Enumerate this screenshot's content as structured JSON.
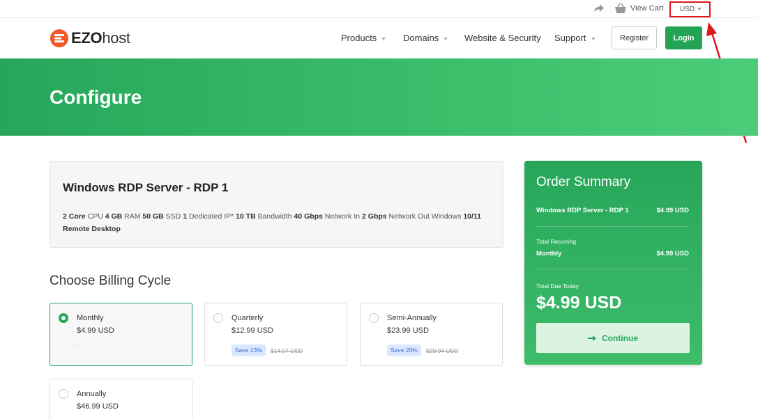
{
  "topbar": {
    "share_icon": "share-arrow-icon",
    "cart_icon": "basket-icon",
    "view_cart": "View Cart",
    "currency": "USD"
  },
  "header": {
    "logo_part1": "EZO",
    "logo_part2": "host",
    "nav": [
      "Products",
      "Domains",
      "Website & Security",
      "Support"
    ],
    "register": "Register",
    "login": "Login"
  },
  "hero": {
    "title": "Configure"
  },
  "product": {
    "name": "Windows RDP Server - RDP 1",
    "specs": [
      {
        "bold": "2 Core",
        "text": " CPU "
      },
      {
        "bold": "4 GB",
        "text": " RAM "
      },
      {
        "bold": "50 GB",
        "text": " SSD "
      },
      {
        "bold": "1",
        "text": " Dedicated IP* "
      },
      {
        "bold": "10 TB",
        "text": " Bandwidth "
      },
      {
        "bold": "40 Gbps",
        "text": " Network In "
      },
      {
        "bold": "2 Gbps",
        "text": " Network Out Windows "
      },
      {
        "bold": "10/11 Remote Desktop",
        "text": ""
      }
    ]
  },
  "billing": {
    "title": "Choose Billing Cycle",
    "options": [
      {
        "name": "Monthly",
        "price": "$4.99 USD",
        "note": "-",
        "selected": true
      },
      {
        "name": "Quarterly",
        "price": "$12.99 USD",
        "save": "Save 13%",
        "old": "$14.97 USD"
      },
      {
        "name": "Semi-Annually",
        "price": "$23.99 USD",
        "save": "Save 20%",
        "old": "$29.94 USD"
      },
      {
        "name": "Annually",
        "price": "$46.99 USD"
      }
    ]
  },
  "summary": {
    "title": "Order Summary",
    "item_name": "Windows RDP Server - RDP 1",
    "item_price": "$4.99 USD",
    "recurring_label": "Total Recurring",
    "recurring_cycle": "Monthly",
    "recurring_price": "$4.99 USD",
    "due_label": "Total Due Today",
    "due_total": "$4.99 USD",
    "continue": "Continue"
  },
  "colors": {
    "brand_green": "#27a65a",
    "annotation_red": "#e0161d",
    "logo_orange": "#f05a28"
  }
}
